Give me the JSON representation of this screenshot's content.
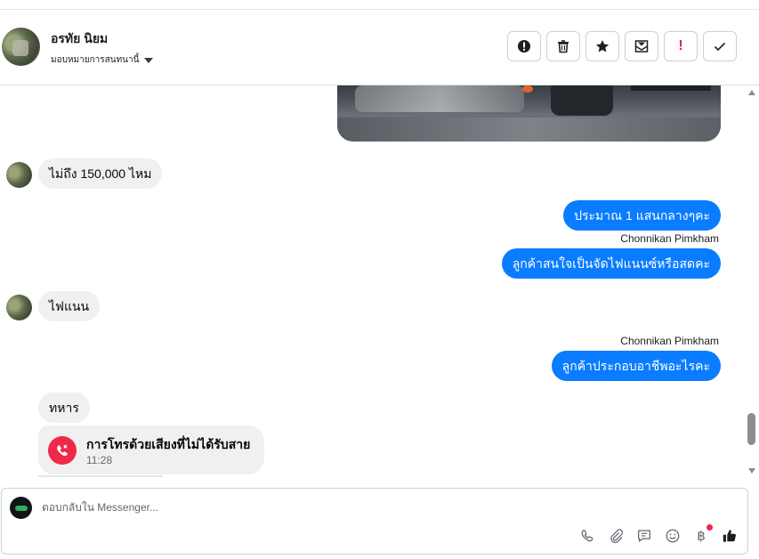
{
  "header": {
    "contact_name": "อรทัย นิยม",
    "assign_label": "มอบหมายการสนทนานี้",
    "actions": [
      {
        "name": "report-icon"
      },
      {
        "name": "trash-icon"
      },
      {
        "name": "star-icon"
      },
      {
        "name": "mark-unread-icon"
      },
      {
        "name": "important-icon"
      },
      {
        "name": "check-icon"
      }
    ]
  },
  "messages": {
    "m1": "ไม่ถึง 150,000 ไหม",
    "m2": "ประมาณ 1 แสนกลางๆคะ",
    "sender1": "Chonnikan Pimkham",
    "m3": "ลูกค้าสนใจเป็นจัดไฟแนนซ์หรือสดคะ",
    "m4": "ไฟแนน",
    "sender2": "Chonnikan Pimkham",
    "m5": "ลูกค้าประกอบอาชีพอะไรคะ",
    "m6": "ทหาร",
    "call_title": "การโทรด้วยเสียงที่ไม่ได้รับสาย",
    "call_time": "11:28"
  },
  "composer": {
    "placeholder": "ตอบกลับใน Messenger...",
    "tools": [
      "phone-icon",
      "attachment-icon",
      "saved-reply-icon",
      "emoji-icon",
      "baht-icon",
      "like-icon"
    ],
    "baht_symbol": "฿"
  },
  "colors": {
    "outgoing_bubble": "#0a7cff",
    "incoming_bubble": "#f0f0f0",
    "missed_call": "#f02849"
  }
}
